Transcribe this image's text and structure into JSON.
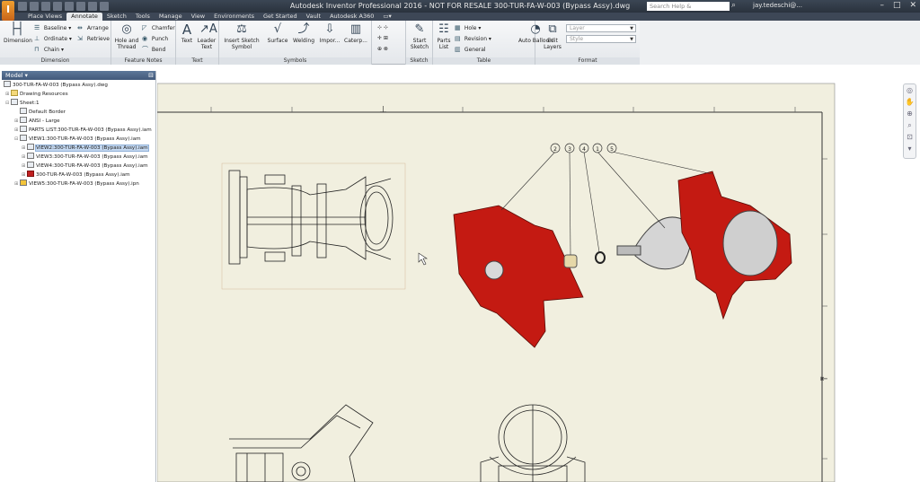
{
  "window": {
    "title": "Autodesk Inventor Professional 2016 - NOT FOR RESALE   300-TUR-FA-W-003 (Bypass Assy).dwg",
    "search_placeholder": "Search Help & Commands...",
    "user": "jay.tedeschi@..."
  },
  "menu_tabs": [
    "Place Views",
    "Annotate",
    "Sketch",
    "Tools",
    "Manage",
    "View",
    "Environments",
    "Get Started",
    "Vault",
    "Autodesk A360"
  ],
  "active_tab": "Annotate",
  "ribbon": {
    "dimension": {
      "label": "Dimension",
      "dimension_btn": "Dimension",
      "baseline": "Baseline",
      "ordinate": "Ordinate",
      "chain": "Chain",
      "arrange": "Arrange",
      "retrieve": "Retrieve"
    },
    "feature_notes": {
      "label": "Feature Notes",
      "hole_thread": "Hole and Thread",
      "chamfer": "Chamfer",
      "punch": "Punch",
      "bend": "Bend"
    },
    "text": {
      "label": "Text",
      "text_btn": "Text",
      "leader_text": "Leader Text"
    },
    "symbols": {
      "label": "Symbols",
      "insert_sketch_symbol": "Insert Sketch Symbol",
      "surface": "Surface",
      "welding": "Welding",
      "import": "Impor...",
      "caterpillar": "Caterp..."
    },
    "sketch": {
      "label": "Sketch",
      "start_sketch": "Start Sketch"
    },
    "table": {
      "label": "Table",
      "parts_list": "Parts List",
      "hole": "Hole",
      "revision": "Revision",
      "general": "General"
    },
    "format": {
      "label": "Format",
      "auto_balloon": "Auto Balloon",
      "edit_layers": "Edit Layers",
      "layer_placeholder": "Layer",
      "style_placeholder": "Style"
    }
  },
  "browser": {
    "title": "Model",
    "nodes": [
      "300-TUR-FA-W-003 (Bypass Assy).dwg",
      "Drawing Resources",
      "Sheet:1",
      "Default Border",
      "ANSI - Large",
      "PARTS LIST:300-TUR-FA-W-003 (Bypass Assy).iam",
      "VIEW1:300-TUR-FA-W-003 (Bypass Assy).iam",
      "VIEW2:300-TUR-FA-W-003 (Bypass Assy).iam",
      "VIEW3:300-TUR-FA-W-003 (Bypass Assy).iam",
      "VIEW4:300-TUR-FA-W-003 (Bypass Assy).iam",
      "300-TUR-FA-W-003 (Bypass Assy).iam",
      "VIEW5:300-TUR-FA-W-003 (Bypass Assy).ipn"
    ]
  },
  "balloons": [
    "2",
    "3",
    "4",
    "1",
    "5"
  ],
  "colors": {
    "part_red": "#c41a12",
    "sheet": "#f1efdf",
    "ribbon_active": "#e8eaed",
    "titlebar": "#2f3845"
  }
}
